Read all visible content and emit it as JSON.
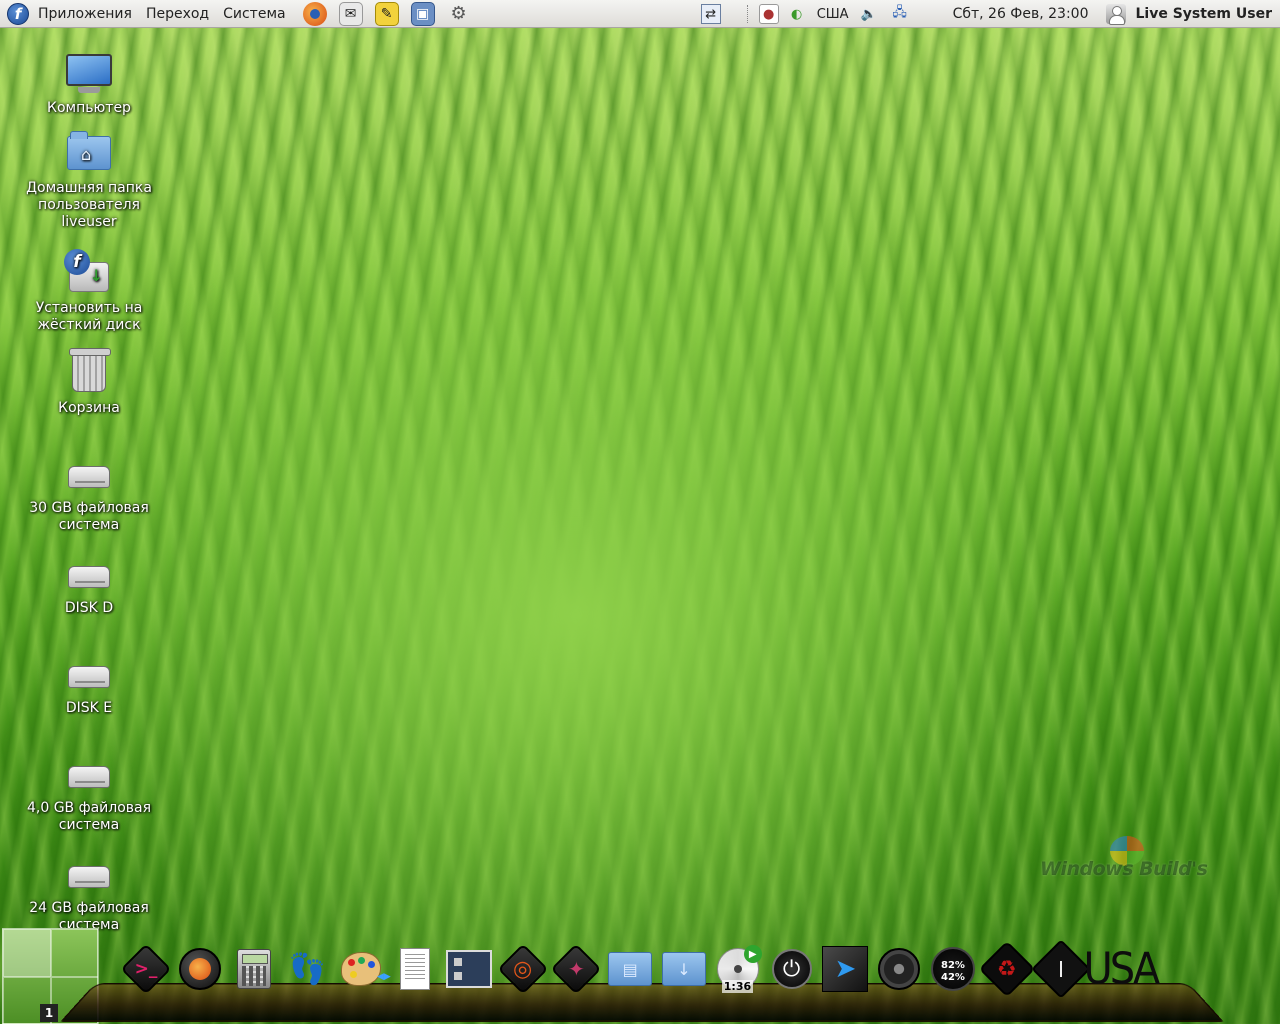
{
  "top_panel": {
    "menus": [
      "Приложения",
      "Переход",
      "Система"
    ],
    "launchers": [
      "firefox-icon",
      "mail-icon",
      "notes-icon",
      "screenshot-icon",
      "settings-icon"
    ],
    "keyboard_layout": "США",
    "datetime": "Сбт, 26 Фев, 23:00",
    "user": "Live System User"
  },
  "desktop": {
    "icons": [
      {
        "label": "Компьютер",
        "icon": "computer-icon"
      },
      {
        "label": "Домашняя папка пользователя liveuser",
        "icon": "home-folder-icon"
      },
      {
        "label": "Установить на жёсткий диск",
        "icon": "install-icon"
      },
      {
        "label": "Корзина",
        "icon": "trash-icon"
      },
      {
        "label": "30 GB файловая система",
        "icon": "drive-icon"
      },
      {
        "label": "DISK D",
        "icon": "drive-icon"
      },
      {
        "label": "DISK E",
        "icon": "drive-icon"
      },
      {
        "label": "4,0 GB файловая система",
        "icon": "drive-icon"
      },
      {
        "label": "24 GB файловая система",
        "icon": "drive-icon"
      }
    ],
    "watermark": "Windows Build's"
  },
  "pager": {
    "active_workspace": "1"
  },
  "dock": {
    "items": [
      "terminal-icon",
      "firefox-icon",
      "calculator-icon",
      "footprints-icon",
      "paint-palette-icon",
      "document-icon",
      "window-switcher-icon",
      "ubuntu-icon",
      "gimp-icon",
      "documents-folder-icon",
      "downloads-folder-icon",
      "cd-player-icon",
      "power-icon",
      "cursor-icon",
      "speaker-icon",
      "cpu-gauge-icon",
      "recycle-icon",
      "clock-icon",
      "usa-label"
    ],
    "terminal_glyph": ">_",
    "cd_time": "1:36",
    "gauge_top": "82%",
    "gauge_bottom": "42%",
    "usa_label": "USA"
  }
}
